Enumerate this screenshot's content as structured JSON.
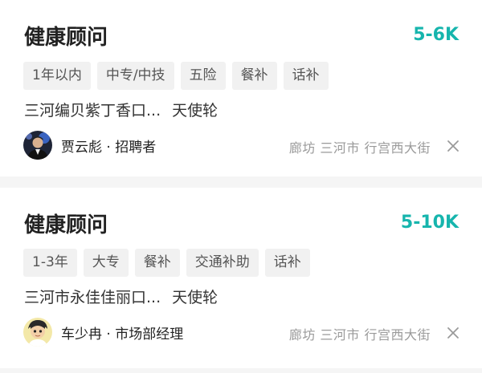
{
  "colors": {
    "accent": "#16b5ad",
    "tag_bg": "#f1f1f1",
    "separator": "#f5f5f5"
  },
  "jobs": [
    {
      "title": "健康顾问",
      "salary": "5-6K",
      "tags": [
        "1年以内",
        "中专/中技",
        "五险",
        "餐补",
        "话补"
      ],
      "company": "三河编贝紫丁香口...",
      "stage": "天使轮",
      "recruiter": "贾云彪 · 招聘者",
      "location": "廊坊 三河市 行宫西大街",
      "close_icon": "close-icon"
    },
    {
      "title": "健康顾问",
      "salary": "5-10K",
      "tags": [
        "1-3年",
        "大专",
        "餐补",
        "交通补助",
        "话补"
      ],
      "company": "三河市永佳佳丽口...",
      "stage": "天使轮",
      "recruiter": "车少冉 · 市场部经理",
      "location": "廊坊 三河市 行宫西大街",
      "close_icon": "close-icon"
    }
  ]
}
